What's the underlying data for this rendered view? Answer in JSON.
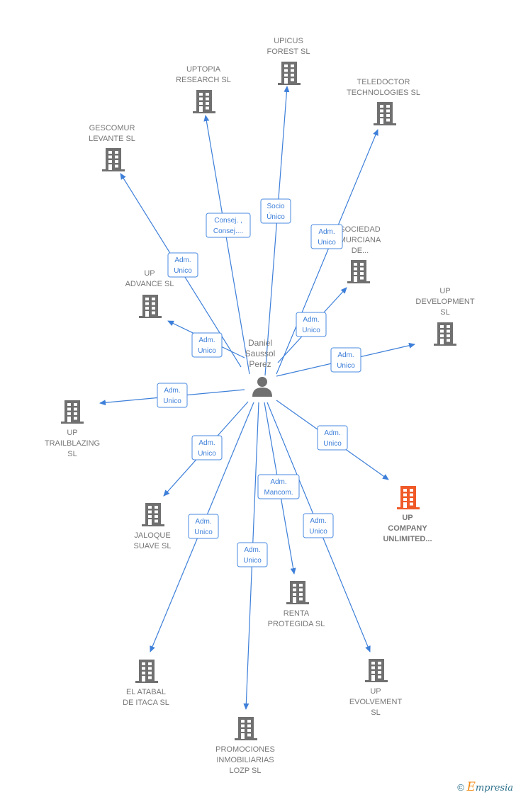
{
  "center": {
    "name_lines": [
      "Daniel",
      "Saussol",
      "Perez"
    ],
    "icon": "person-icon"
  },
  "colors": {
    "edge": "#3d7fd9",
    "node": "#707070",
    "highlight": "#f05a28"
  },
  "nodes": [
    {
      "id": "upicus",
      "label_lines": [
        "UPICUS",
        "FOREST  SL"
      ],
      "relation_lines": [
        "Socio",
        "Único"
      ]
    },
    {
      "id": "uptopia",
      "label_lines": [
        "UPTOPIA",
        "RESEARCH  SL"
      ],
      "relation_lines": [
        "Consej. ,",
        "Consej...."
      ]
    },
    {
      "id": "teledoctor",
      "label_lines": [
        "TELEDOCTOR",
        "TECHNOLOGIES SL"
      ],
      "relation_lines": [
        "Adm.",
        "Unico"
      ]
    },
    {
      "id": "gescomur",
      "label_lines": [
        "GESCOMUR",
        "LEVANTE SL"
      ],
      "relation_lines": [
        "Adm.",
        "Unico"
      ]
    },
    {
      "id": "sociedad",
      "label_lines": [
        "SOCIEDAD",
        "MURCIANA",
        "DE..."
      ],
      "relation_lines": [
        "Adm.",
        "Unico"
      ]
    },
    {
      "id": "up-advance",
      "label_lines": [
        "UP",
        "ADVANCE  SL"
      ],
      "relation_lines": [
        "Adm.",
        "Unico"
      ]
    },
    {
      "id": "up-development",
      "label_lines": [
        "UP",
        "DEVELOPMENT",
        "SL"
      ],
      "relation_lines": [
        "Adm.",
        "Unico"
      ]
    },
    {
      "id": "up-trailblazing",
      "label_lines": [
        "UP",
        "TRAILBLAZING",
        "SL"
      ],
      "relation_lines": [
        "Adm.",
        "Unico"
      ]
    },
    {
      "id": "jaloque",
      "label_lines": [
        "JALOQUE",
        "SUAVE  SL"
      ],
      "relation_lines": [
        "Adm.",
        "Unico"
      ]
    },
    {
      "id": "up-company",
      "label_lines": [
        "UP",
        "COMPANY",
        "UNLIMITED..."
      ],
      "relation_lines": [
        "Adm.",
        "Unico"
      ],
      "highlight": true
    },
    {
      "id": "renta",
      "label_lines": [
        "RENTA",
        "PROTEGIDA SL"
      ],
      "relation_lines": [
        "Adm.",
        "Mancom."
      ]
    },
    {
      "id": "el-atabal",
      "label_lines": [
        "EL ATABAL",
        "DE ITACA  SL"
      ],
      "relation_lines": [
        "Adm.",
        "Unico"
      ]
    },
    {
      "id": "up-evolvement",
      "label_lines": [
        "UP",
        "EVOLVEMENT",
        "SL"
      ],
      "relation_lines": [
        "Adm.",
        "Unico"
      ]
    },
    {
      "id": "promociones",
      "label_lines": [
        "PROMOCIONES",
        "INMOBILIARIAS",
        "LOZP SL"
      ],
      "relation_lines": [
        "Adm.",
        "Unico"
      ]
    }
  ],
  "footer": {
    "copyright": "©",
    "brand_initial": "E",
    "brand_rest": "mpresia"
  }
}
